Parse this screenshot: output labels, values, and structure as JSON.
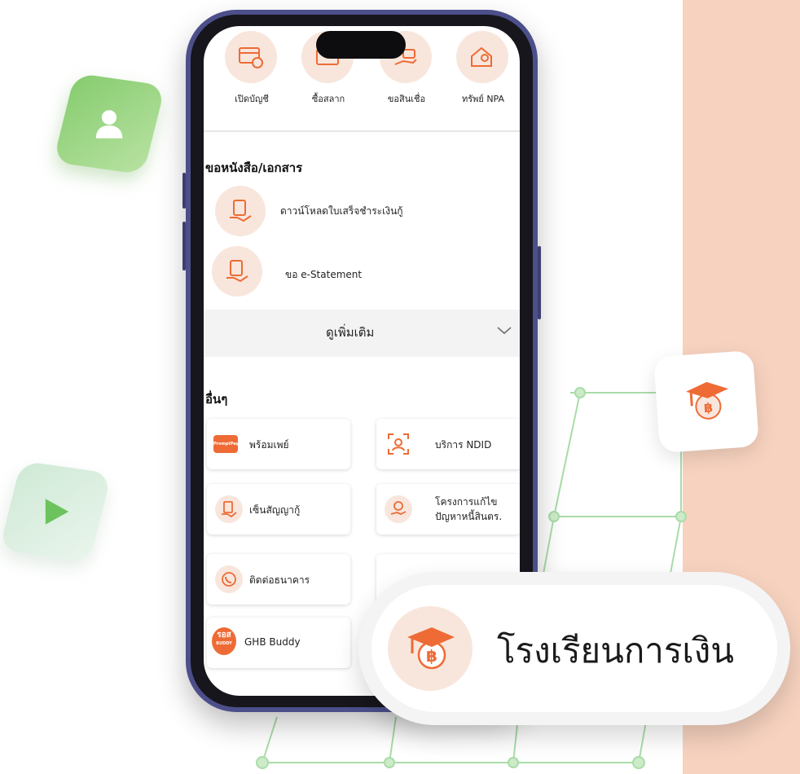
{
  "top_menu": [
    {
      "label": "เปิดบัญชี",
      "icon": "open-account-icon"
    },
    {
      "label": "ซื้อสลาก",
      "icon": "lottery-icon"
    },
    {
      "label": "ขอสินเชื่อ",
      "icon": "loan-icon"
    },
    {
      "label": "ทรัพย์ NPA",
      "icon": "npa-property-icon"
    }
  ],
  "documents": {
    "title": "ขอหนังสือ/เอกสาร",
    "items": [
      {
        "label": "ดาวน์โหลดใบเสร็จชำระเงินกู้",
        "icon": "receipt-document-icon"
      },
      {
        "label": "ขอ e-Statement",
        "icon": "e-statement-icon"
      }
    ]
  },
  "more": {
    "label": "ดูเพิ่มเติม",
    "icon": "chevron-down-icon"
  },
  "others": {
    "title": "อื่นๆ",
    "cards": [
      {
        "label": "พร้อมเพย์",
        "icon": "promptpay-icon",
        "badge": "PromptPay"
      },
      {
        "label": "บริการ NDID",
        "icon": "ndid-face-scan-icon"
      },
      {
        "label": "เซ็นสัญญากู้",
        "icon": "sign-contract-icon"
      },
      {
        "label_line1": "โครงการแก้ไข",
        "label_line2": "ปัญหาหนี้สินตร.",
        "icon": "debt-solution-icon"
      },
      {
        "label": "ติดต่อธนาคาร",
        "icon": "contact-bank-icon"
      },
      {
        "label": "GHB Buddy",
        "icon": "ghb-buddy-logo",
        "badge_line1": "รอส",
        "badge_line2": "BUDDY"
      }
    ]
  },
  "overlay": {
    "title": "โรงเรียนการเงิน",
    "icon": "graduation-cap-baht-icon"
  },
  "floating_icons": [
    "user-icon",
    "play-icon",
    "graduation-cap-baht-icon"
  ],
  "colors": {
    "accent": "#ee6b35",
    "icon_bg": "#f8e6dc",
    "side_panel": "#f7d2bf",
    "green_tile": "#86cc6e",
    "grid_line": "#9fd9a1",
    "phone_frame": "#4c4f8a"
  }
}
